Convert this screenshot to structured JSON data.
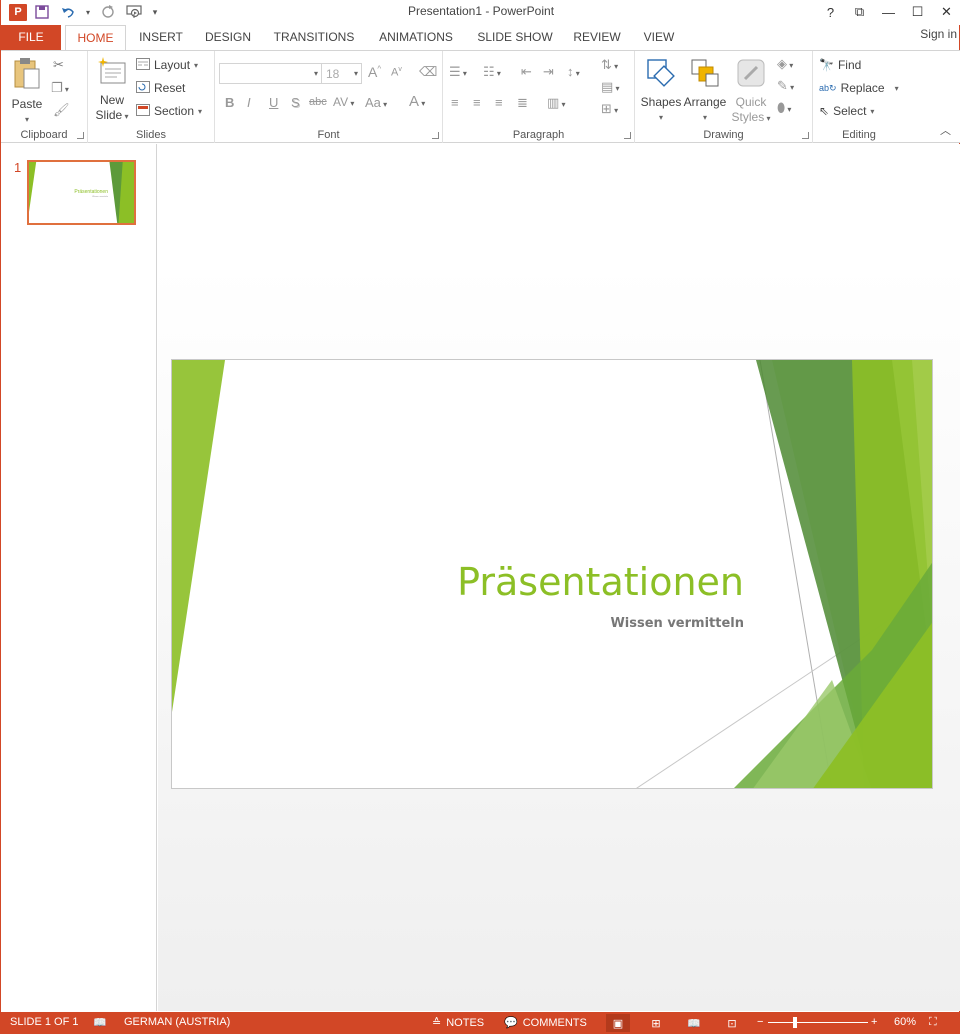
{
  "app": {
    "window_title": "Presentation1 - PowerPoint",
    "logo_letter": "P"
  },
  "window_controls": [
    "?",
    "⧉",
    "—",
    "☐",
    "✕"
  ],
  "tabs": [
    {
      "id": "file",
      "label": "FILE"
    },
    {
      "id": "home",
      "label": "HOME",
      "active": true
    },
    {
      "id": "insert",
      "label": "INSERT"
    },
    {
      "id": "design",
      "label": "DESIGN"
    },
    {
      "id": "transitions",
      "label": "TRANSITIONS"
    },
    {
      "id": "animations",
      "label": "ANIMATIONS"
    },
    {
      "id": "slideshow",
      "label": "SLIDE SHOW"
    },
    {
      "id": "review",
      "label": "REVIEW"
    },
    {
      "id": "view",
      "label": "VIEW"
    }
  ],
  "signin": "Sign in",
  "ribbon": {
    "clipboard": {
      "label": "Clipboard",
      "paste": "Paste"
    },
    "slides": {
      "label": "Slides",
      "new_slide_line1": "New",
      "new_slide_line2": "Slide",
      "layout": "Layout",
      "reset": "Reset",
      "section": "Section"
    },
    "font": {
      "label": "Font",
      "font_name": "",
      "font_size": "18",
      "bold": "B",
      "italic": "I",
      "underline": "U",
      "shadow": "S",
      "strike": "abc",
      "spacing": "AV",
      "case": "Aa",
      "color": "A"
    },
    "paragraph": {
      "label": "Paragraph"
    },
    "drawing": {
      "label": "Drawing",
      "shapes": "Shapes",
      "arrange": "Arrange",
      "quick_styles_line1": "Quick",
      "quick_styles_line2": "Styles"
    },
    "editing": {
      "label": "Editing",
      "find": "Find",
      "replace": "Replace",
      "select": "Select"
    }
  },
  "thumbnails": [
    {
      "number": "1",
      "title": "Präsentationen",
      "subtitle": "Wissen vermitteln"
    }
  ],
  "slide": {
    "title": "Präsentationen",
    "subtitle": "Wissen vermitteln",
    "accent": "#8cbf26"
  },
  "status": {
    "slide_info": "SLIDE 1 OF 1",
    "language": "GERMAN (AUSTRIA)",
    "notes": "NOTES",
    "comments": "COMMENTS",
    "zoom": "60%"
  },
  "colors": {
    "brand": "#d24726",
    "slide_green": "#8cbf26"
  }
}
